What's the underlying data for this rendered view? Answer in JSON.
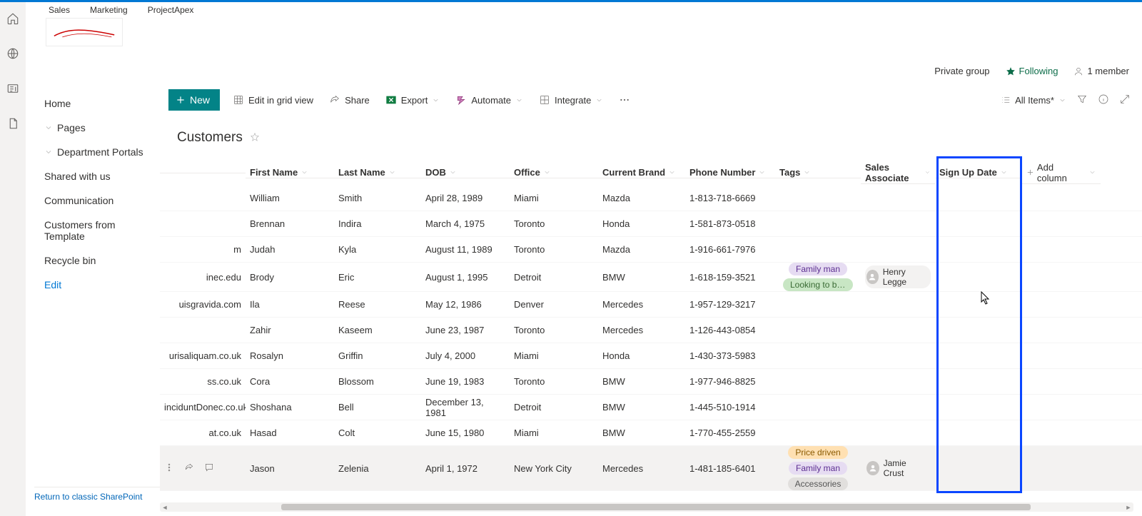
{
  "breadcrumbs": [
    "Sales",
    "Marketing",
    "ProjectApex"
  ],
  "headerInfo": {
    "privateGroup": "Private group",
    "following": "Following",
    "memberCount": "1 member"
  },
  "leftNav": {
    "home": "Home",
    "pages": "Pages",
    "deptPortals": "Department Portals",
    "shared": "Shared with us",
    "communication": "Communication",
    "cft": "Customers from Template",
    "recycle": "Recycle bin",
    "edit": "Edit",
    "classic": "Return to classic SharePoint"
  },
  "commands": {
    "new": "New",
    "editGrid": "Edit in grid view",
    "share": "Share",
    "export": "Export",
    "automate": "Automate",
    "integrate": "Integrate",
    "allItems": "All Items*"
  },
  "listTitle": "Customers",
  "columns": {
    "first": "First Name",
    "last": "Last Name",
    "dob": "DOB",
    "office": "Office",
    "brand": "Current Brand",
    "phone": "Phone Number",
    "tags": "Tags",
    "assoc": "Sales Associate",
    "sign": "Sign Up Date",
    "add": "Add column"
  },
  "rows": [
    {
      "email": "",
      "first": "William",
      "last": "Smith",
      "dob": "April 28, 1989",
      "office": "Miami",
      "brand": "Mazda",
      "phone": "1-813-718-6669",
      "tags": [],
      "assoc": ""
    },
    {
      "email": "",
      "first": "Brennan",
      "last": "Indira",
      "dob": "March 4, 1975",
      "office": "Toronto",
      "brand": "Honda",
      "phone": "1-581-873-0518",
      "tags": [],
      "assoc": ""
    },
    {
      "email": "m",
      "first": "Judah",
      "last": "Kyla",
      "dob": "August 11, 1989",
      "office": "Toronto",
      "brand": "Mazda",
      "phone": "1-916-661-7976",
      "tags": [],
      "assoc": ""
    },
    {
      "email": "inec.edu",
      "first": "Brody",
      "last": "Eric",
      "dob": "August 1, 1995",
      "office": "Detroit",
      "brand": "BMW",
      "phone": "1-618-159-3521",
      "tags": [
        "Family man",
        "Looking to buy s..."
      ],
      "assoc": "Henry Legge"
    },
    {
      "email": "uisgravida.com",
      "first": "Ila",
      "last": "Reese",
      "dob": "May 12, 1986",
      "office": "Denver",
      "brand": "Mercedes",
      "phone": "1-957-129-3217",
      "tags": [],
      "assoc": ""
    },
    {
      "email": "",
      "first": "Zahir",
      "last": "Kaseem",
      "dob": "June 23, 1987",
      "office": "Toronto",
      "brand": "Mercedes",
      "phone": "1-126-443-0854",
      "tags": [],
      "assoc": ""
    },
    {
      "email": "urisaliquam.co.uk",
      "first": "Rosalyn",
      "last": "Griffin",
      "dob": "July 4, 2000",
      "office": "Miami",
      "brand": "Honda",
      "phone": "1-430-373-5983",
      "tags": [],
      "assoc": ""
    },
    {
      "email": "ss.co.uk",
      "first": "Cora",
      "last": "Blossom",
      "dob": "June 19, 1983",
      "office": "Toronto",
      "brand": "BMW",
      "phone": "1-977-946-8825",
      "tags": [],
      "assoc": ""
    },
    {
      "email": "inciduntDonec.co.uk",
      "first": "Shoshana",
      "last": "Bell",
      "dob": "December 13, 1981",
      "office": "Detroit",
      "brand": "BMW",
      "phone": "1-445-510-1914",
      "tags": [],
      "assoc": ""
    },
    {
      "email": "at.co.uk",
      "first": "Hasad",
      "last": "Colt",
      "dob": "June 15, 1980",
      "office": "Miami",
      "brand": "BMW",
      "phone": "1-770-455-2559",
      "tags": [],
      "assoc": ""
    },
    {
      "email": "",
      "first": "Jason",
      "last": "Zelenia",
      "dob": "April 1, 1972",
      "office": "New York City",
      "brand": "Mercedes",
      "phone": "1-481-185-6401",
      "tags": [
        "Price driven",
        "Family man",
        "Accessories"
      ],
      "assoc": "Jamie Crust",
      "active": true
    }
  ]
}
